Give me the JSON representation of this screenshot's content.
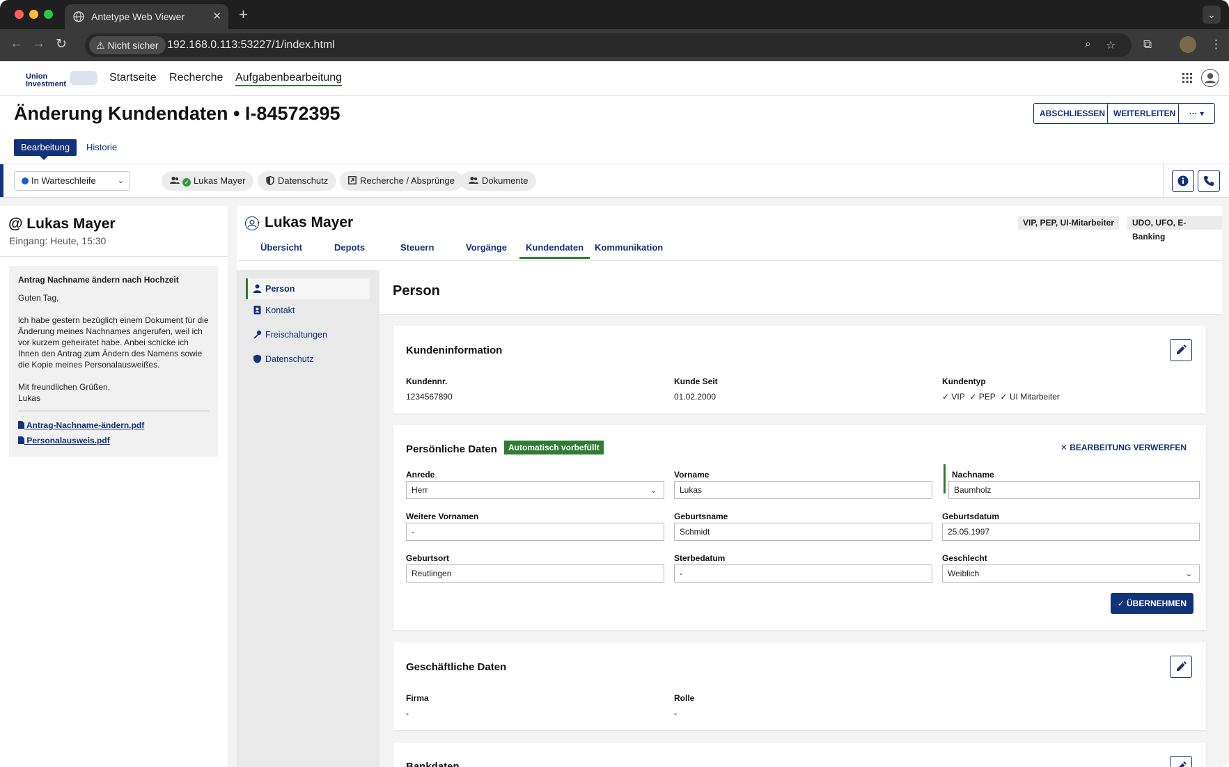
{
  "browser": {
    "tab_title": "Antetype Web Viewer",
    "security_chip": "Nicht sicher",
    "url": "192.168.0.113:53227/1/index.html"
  },
  "app": {
    "logo_line1": "Union",
    "logo_line2": "Investment",
    "nav": [
      "Startseite",
      "Recherche",
      "Aufgabenbearbeitung"
    ],
    "page_title": "Änderung Kundendaten • I-84572395",
    "tabs": [
      "Bearbeitung",
      "Historie"
    ],
    "actions": {
      "close": "ABSCHLIESSEN",
      "forward": "WEITERLEITEN",
      "more": "··· ▾"
    }
  },
  "context": {
    "status": "In Warteschleife",
    "chips": [
      "Lukas Mayer",
      "Datenschutz",
      "Recherche / Absprünge",
      "Dokumente"
    ]
  },
  "email": {
    "sender": "@ Lukas Mayer",
    "received": "Eingang: Heute, 15:30",
    "subject": "Antrag Nachname ändern nach Hochzeit",
    "greeting": "Guten Tag,",
    "body": "ich habe gestern bezüglich einem Dokument für die Änderung meines Nachnames angerufen, weil ich vor kurzem geheiratet habe. Anbei schicke ich Ihnen den Antrag zum Ändern des Namens sowie die Kopie meines Personalausweißes.",
    "closing": "Mit freundlichen Grüßen,",
    "signature": "Lukas",
    "attachments": [
      "Antrag-Nachname-ändern.pdf",
      "Personalausweis.pdf"
    ]
  },
  "customer": {
    "name": "Lukas Mayer",
    "tags": [
      "VIP, PEP, UI-Mitarbeiter",
      "UDO, UFO, E-Banking"
    ],
    "subtabs": [
      "Übersicht",
      "Depots",
      "Steuern",
      "Vorgänge",
      "Kundendaten",
      "Kommunikation"
    ],
    "sidenav": [
      "Person",
      "Kontakt",
      "Freischaltungen",
      "Datenschutz"
    ],
    "content_title": "Person"
  },
  "kundeninfo": {
    "title": "Kundeninformation",
    "kundennr_label": "Kundennr.",
    "kundennr": "1234567890",
    "seit_label": "Kunde Seit",
    "seit": "01.02.2000",
    "typ_label": "Kundentyp",
    "typen": [
      "VIP",
      "PEP",
      "UI Mitarbeiter"
    ]
  },
  "personal": {
    "title": "Persönliche Daten",
    "badge": "Automatisch vorbefüllt",
    "discard": "BEARBEITUNG VERWERFEN",
    "fields": [
      {
        "label": "Anrede",
        "value": "Herr"
      },
      {
        "label": "Vorname",
        "value": "Lukas"
      },
      {
        "label": "Nachname",
        "value": "Baumholz"
      },
      {
        "label": "Weitere Vornamen",
        "value": "-"
      },
      {
        "label": "Geburtsname",
        "value": "Schmidt"
      },
      {
        "label": "Geburtsdatum",
        "value": "25.05.1997"
      },
      {
        "label": "Geburtsort",
        "value": "Reutlingen"
      },
      {
        "label": "Sterbedatum",
        "value": "-"
      },
      {
        "label": "Geschlecht",
        "value": "Weiblich"
      }
    ],
    "accept": "ÜBERNEHMEN"
  },
  "business": {
    "title": "Geschäftliche Daten",
    "firma_label": "Firma",
    "firma": "-",
    "rolle_label": "Rolle",
    "rolle": "-"
  },
  "bank": {
    "title": "Bankdaten"
  },
  "colors": {
    "primary": "#12327a",
    "accent_green": "#2e7d32",
    "status_blue": "#1f5bd1"
  }
}
